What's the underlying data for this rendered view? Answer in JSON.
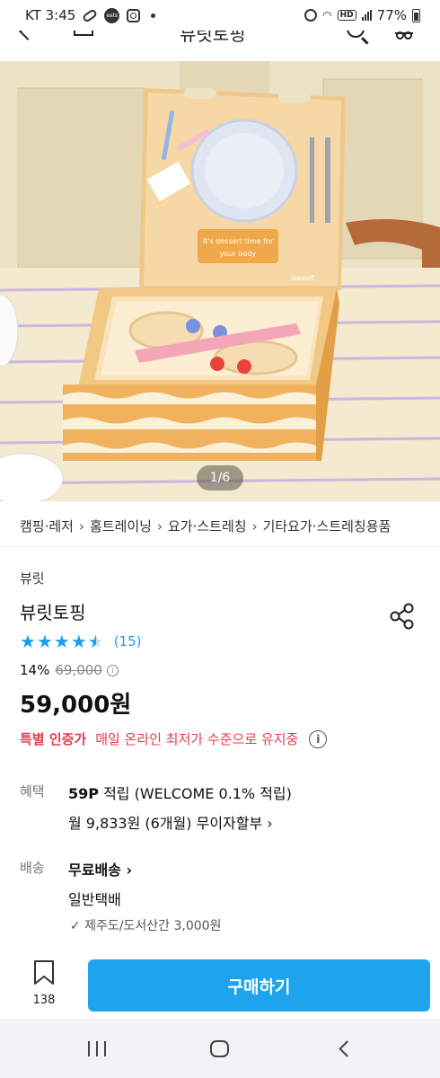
{
  "status_bar": {
    "carrier_time": "KT 3:45",
    "battery": "77%",
    "eats_label": "eats"
  },
  "header": {
    "title": "뷰릿토핑"
  },
  "image": {
    "counter": "1/6",
    "box_text_line1": "It's dessert time for",
    "box_text_line2": "your body",
    "box_brand": "beauit"
  },
  "breadcrumb": [
    "캠핑·레저",
    "홈트레이닝",
    "요가·스트레칭",
    "기타요가·스트레칭용품"
  ],
  "product": {
    "brand": "뷰릿",
    "title": "뷰릿토핑",
    "rating": 4.5,
    "review_count": "(15)",
    "discount": "14%",
    "original_price": "69,000",
    "sale_price": "59,000원"
  },
  "certified": {
    "label": "특별 인증가",
    "text": "매일 온라인 최저가 수준으로 유지중"
  },
  "benefit": {
    "label": "혜택",
    "points": "59P",
    "points_rest": " 적립 (WELCOME 0.1% 적립)",
    "installment": "월 9,833원 (6개월) 무이자할부 ›"
  },
  "shipping": {
    "label": "배송",
    "type": "무료배송 ›",
    "method": "일반택배",
    "extra": "✓ 제주도/도서산간 3,000원"
  },
  "bottom_bar": {
    "wishlist_count": "138",
    "buy_label": "구매하기"
  },
  "colors": {
    "accent": "#1ea4ee",
    "star": "#1f9ee8",
    "highlight_red": "#e83a4b"
  }
}
